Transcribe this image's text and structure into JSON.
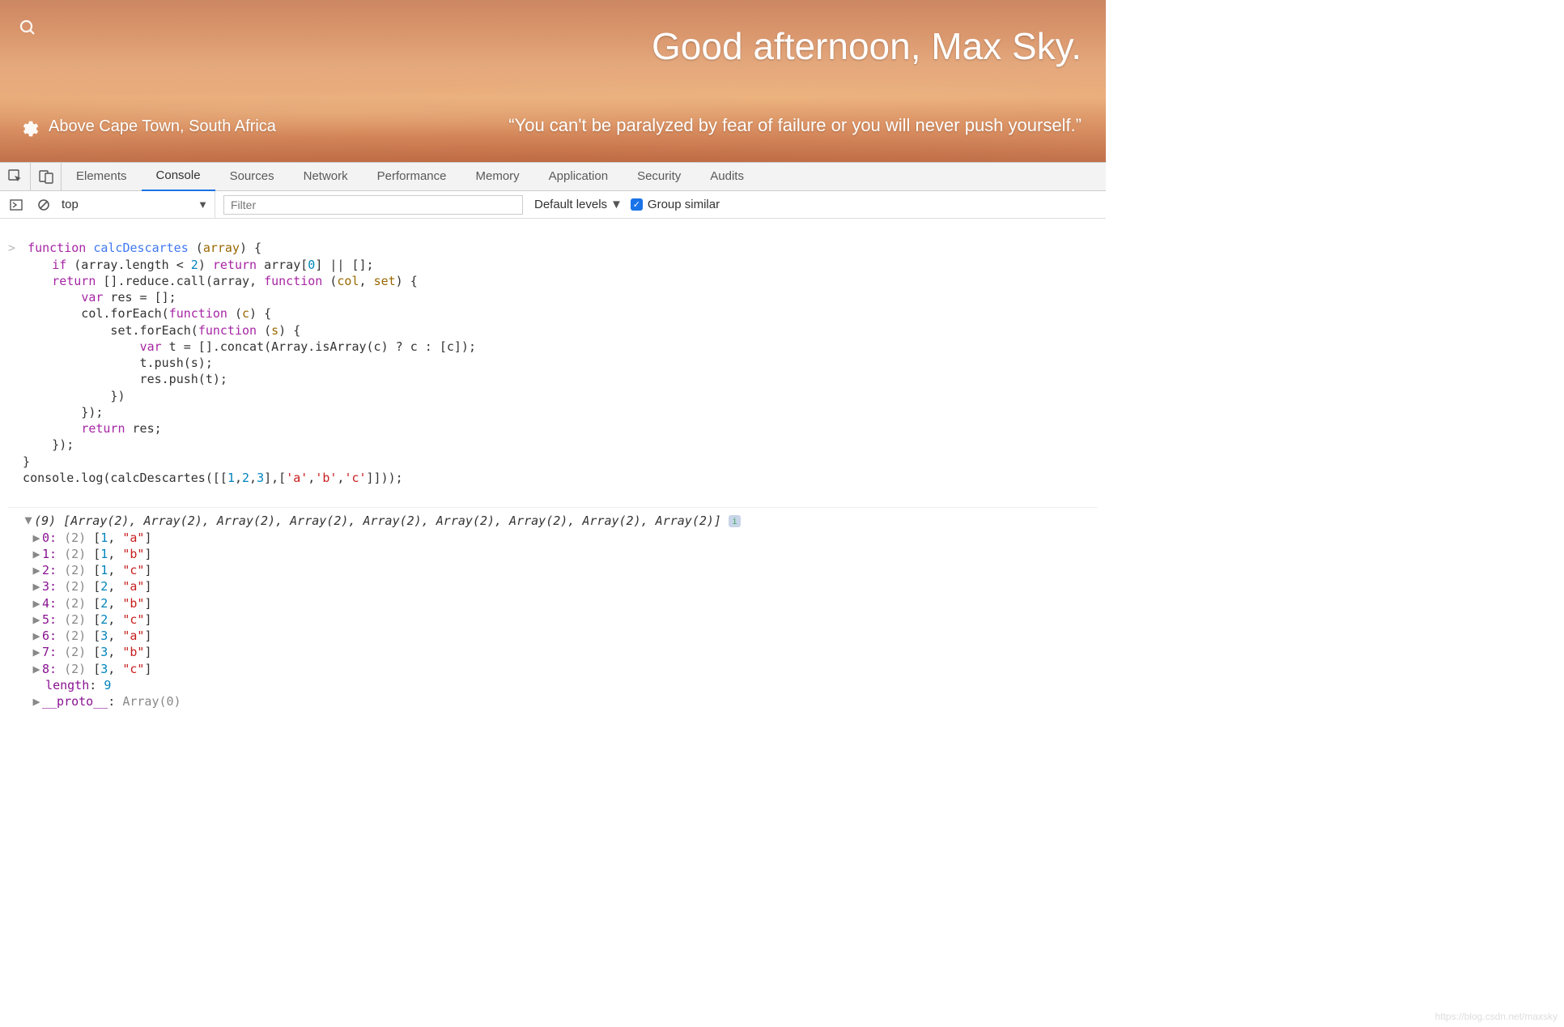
{
  "hero": {
    "greeting": "Good afternoon, Max Sky.",
    "location": "Above Cape Town, South Africa",
    "quote": "“You can't be paralyzed by fear of failure or you will never push yourself.”"
  },
  "devtools": {
    "tabs": [
      "Elements",
      "Console",
      "Sources",
      "Network",
      "Performance",
      "Memory",
      "Application",
      "Security",
      "Audits"
    ],
    "active_tab": "Console"
  },
  "console_toolbar": {
    "context": "top",
    "filter_placeholder": "Filter",
    "levels_label": "Default levels",
    "group_label": "Group similar",
    "group_checked": true
  },
  "code_tokens": [
    [
      {
        "t": "prompt",
        "v": "> "
      },
      {
        "t": "kw",
        "v": "function"
      },
      {
        "t": "prop",
        "v": " "
      },
      {
        "t": "fnname",
        "v": "calcDescartes"
      },
      {
        "t": "prop",
        "v": " ("
      },
      {
        "t": "param",
        "v": "array"
      },
      {
        "t": "prop",
        "v": ") {"
      }
    ],
    [
      {
        "t": "prop",
        "v": "      "
      },
      {
        "t": "kw",
        "v": "if"
      },
      {
        "t": "prop",
        "v": " (array.length < "
      },
      {
        "t": "num",
        "v": "2"
      },
      {
        "t": "prop",
        "v": ") "
      },
      {
        "t": "kw",
        "v": "return"
      },
      {
        "t": "prop",
        "v": " array["
      },
      {
        "t": "num",
        "v": "0"
      },
      {
        "t": "prop",
        "v": "] || [];"
      }
    ],
    [
      {
        "t": "prop",
        "v": "      "
      },
      {
        "t": "kw",
        "v": "return"
      },
      {
        "t": "prop",
        "v": " [].reduce.call(array, "
      },
      {
        "t": "kw",
        "v": "function"
      },
      {
        "t": "prop",
        "v": " ("
      },
      {
        "t": "param",
        "v": "col"
      },
      {
        "t": "prop",
        "v": ", "
      },
      {
        "t": "param",
        "v": "set"
      },
      {
        "t": "prop",
        "v": ") {"
      }
    ],
    [
      {
        "t": "prop",
        "v": "          "
      },
      {
        "t": "kw",
        "v": "var"
      },
      {
        "t": "prop",
        "v": " res = [];"
      }
    ],
    [
      {
        "t": "prop",
        "v": "          col.forEach("
      },
      {
        "t": "kw",
        "v": "function"
      },
      {
        "t": "prop",
        "v": " ("
      },
      {
        "t": "param",
        "v": "c"
      },
      {
        "t": "prop",
        "v": ") {"
      }
    ],
    [
      {
        "t": "prop",
        "v": "              set.forEach("
      },
      {
        "t": "kw",
        "v": "function"
      },
      {
        "t": "prop",
        "v": " ("
      },
      {
        "t": "param",
        "v": "s"
      },
      {
        "t": "prop",
        "v": ") {"
      }
    ],
    [
      {
        "t": "prop",
        "v": "                  "
      },
      {
        "t": "kw",
        "v": "var"
      },
      {
        "t": "prop",
        "v": " t = [].concat(Array.isArray(c) ? c : [c]);"
      }
    ],
    [
      {
        "t": "prop",
        "v": "                  t.push(s);"
      }
    ],
    [
      {
        "t": "prop",
        "v": "                  res.push(t);"
      }
    ],
    [
      {
        "t": "prop",
        "v": "              })"
      }
    ],
    [
      {
        "t": "prop",
        "v": "          });"
      }
    ],
    [
      {
        "t": "prop",
        "v": "          "
      },
      {
        "t": "kw",
        "v": "return"
      },
      {
        "t": "prop",
        "v": " res;"
      }
    ],
    [
      {
        "t": "prop",
        "v": "      });"
      }
    ],
    [
      {
        "t": "prop",
        "v": "  }"
      }
    ],
    [
      {
        "t": "prop",
        "v": ""
      }
    ],
    [
      {
        "t": "prop",
        "v": "  console.log(calcDescartes([["
      },
      {
        "t": "num",
        "v": "1"
      },
      {
        "t": "prop",
        "v": ","
      },
      {
        "t": "num",
        "v": "2"
      },
      {
        "t": "prop",
        "v": ","
      },
      {
        "t": "num",
        "v": "3"
      },
      {
        "t": "prop",
        "v": "],["
      },
      {
        "t": "str",
        "v": "'a'"
      },
      {
        "t": "prop",
        "v": ","
      },
      {
        "t": "str",
        "v": "'b'"
      },
      {
        "t": "prop",
        "v": ","
      },
      {
        "t": "str",
        "v": "'c'"
      },
      {
        "t": "prop",
        "v": "]]));"
      }
    ]
  ],
  "output": {
    "header_count": 9,
    "header_text": "[Array(2), Array(2), Array(2), Array(2), Array(2), Array(2), Array(2), Array(2), Array(2)]",
    "rows": [
      {
        "idx": "0",
        "len": "(2)",
        "a": 1,
        "b": "\"a\""
      },
      {
        "idx": "1",
        "len": "(2)",
        "a": 1,
        "b": "\"b\""
      },
      {
        "idx": "2",
        "len": "(2)",
        "a": 1,
        "b": "\"c\""
      },
      {
        "idx": "3",
        "len": "(2)",
        "a": 2,
        "b": "\"a\""
      },
      {
        "idx": "4",
        "len": "(2)",
        "a": 2,
        "b": "\"b\""
      },
      {
        "idx": "5",
        "len": "(2)",
        "a": 2,
        "b": "\"c\""
      },
      {
        "idx": "6",
        "len": "(2)",
        "a": 3,
        "b": "\"a\""
      },
      {
        "idx": "7",
        "len": "(2)",
        "a": 3,
        "b": "\"b\""
      },
      {
        "idx": "8",
        "len": "(2)",
        "a": 3,
        "b": "\"c\""
      }
    ],
    "length_label": "length",
    "length_value": 9,
    "proto_label": "__proto__",
    "proto_value": "Array(0)"
  },
  "watermark": "https://blog.csdn.net/maxsky"
}
